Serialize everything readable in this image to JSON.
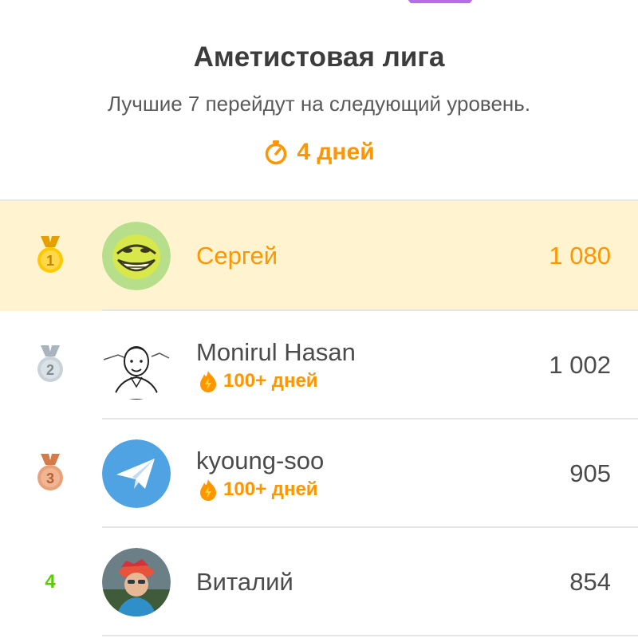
{
  "league": {
    "title": "Аметистовая лига",
    "subtitle": "Лучшие 7 перейдут на следующий уровень.",
    "timer": "4 дней",
    "badge_icon": "amethyst-league-badge-icon",
    "accent_color": "#ff9600"
  },
  "rows": [
    {
      "rank": "1",
      "rank_icon": "gold-medal-icon",
      "name": "Сергей",
      "xp": "1 080",
      "streak": "",
      "avatar": "troll-face-avatar",
      "highlight": true
    },
    {
      "rank": "2",
      "rank_icon": "silver-medal-icon",
      "name": "Monirul Hasan",
      "xp": "1 002",
      "streak": "100+ дней",
      "avatar": "sketch-portrait-avatar"
    },
    {
      "rank": "3",
      "rank_icon": "bronze-medal-icon",
      "name": "kyoung-soo",
      "xp": "905",
      "streak": "100+ дней",
      "avatar": "telegram-avatar"
    },
    {
      "rank": "4",
      "name": "Виталий",
      "xp": "854",
      "streak": "",
      "avatar": "photo-avatar"
    }
  ]
}
